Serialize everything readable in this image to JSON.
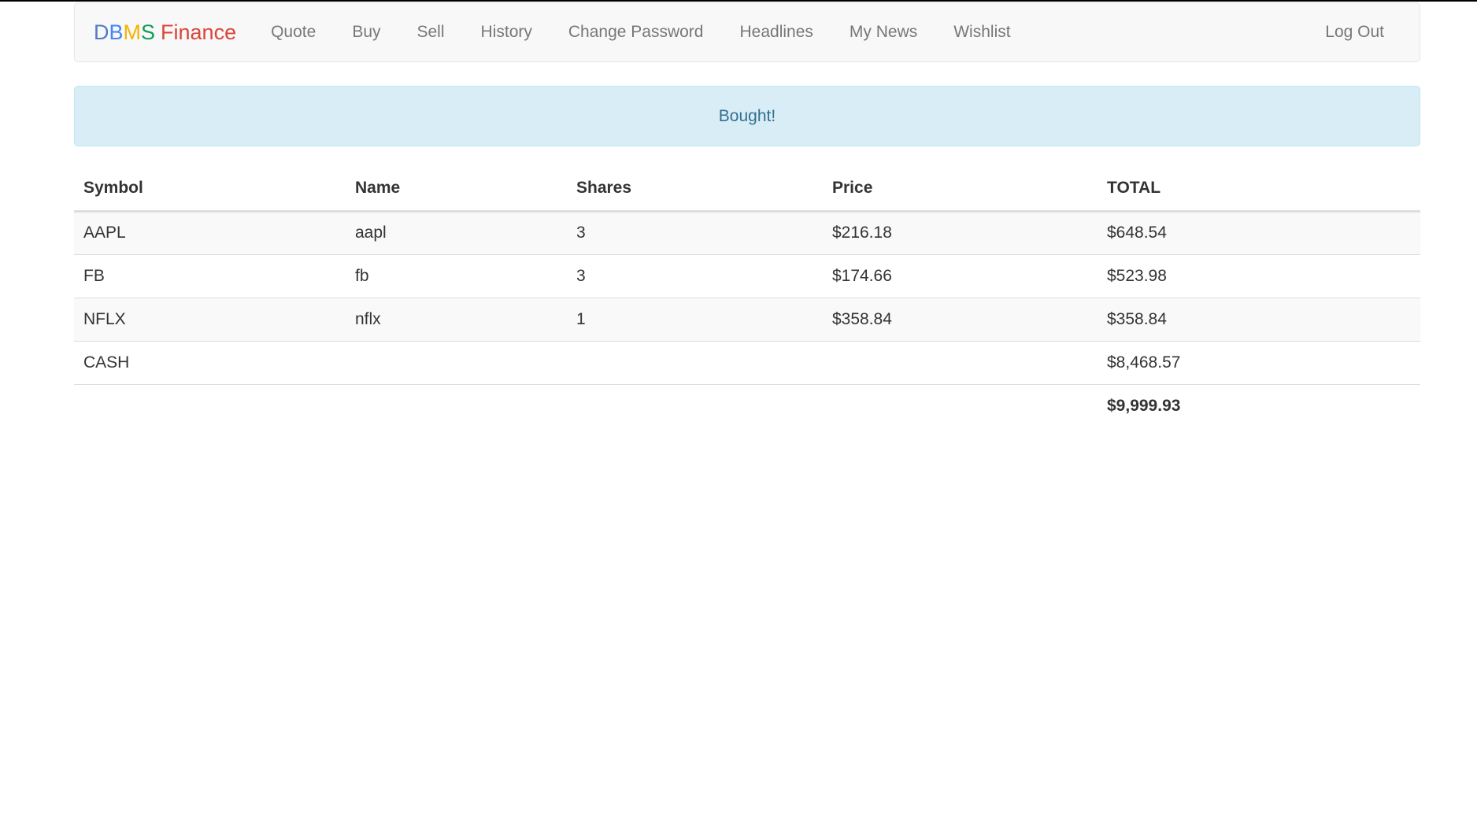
{
  "brand": {
    "letters": [
      {
        "text": "D",
        "color": "#537bc4"
      },
      {
        "text": "B",
        "color": "#4285f4"
      },
      {
        "text": "M",
        "color": "#f4b400"
      },
      {
        "text": "S",
        "color": "#0f9d58"
      }
    ],
    "word": "Finance",
    "word_color": "#db4437"
  },
  "nav": {
    "links": [
      "Quote",
      "Buy",
      "Sell",
      "History",
      "Change Password",
      "Headlines",
      "My News",
      "Wishlist"
    ],
    "logout": "Log Out"
  },
  "alert": {
    "message": "Bought!"
  },
  "table": {
    "headers": [
      "Symbol",
      "Name",
      "Shares",
      "Price",
      "TOTAL"
    ],
    "rows": [
      {
        "symbol": "AAPL",
        "name": "aapl",
        "shares": "3",
        "price": "$216.18",
        "total": "$648.54"
      },
      {
        "symbol": "FB",
        "name": "fb",
        "shares": "3",
        "price": "$174.66",
        "total": "$523.98"
      },
      {
        "symbol": "NFLX",
        "name": "nflx",
        "shares": "1",
        "price": "$358.84",
        "total": "$358.84"
      }
    ],
    "cash": {
      "label": "CASH",
      "total": "$8,468.57"
    },
    "grand_total": "$9,999.93"
  }
}
